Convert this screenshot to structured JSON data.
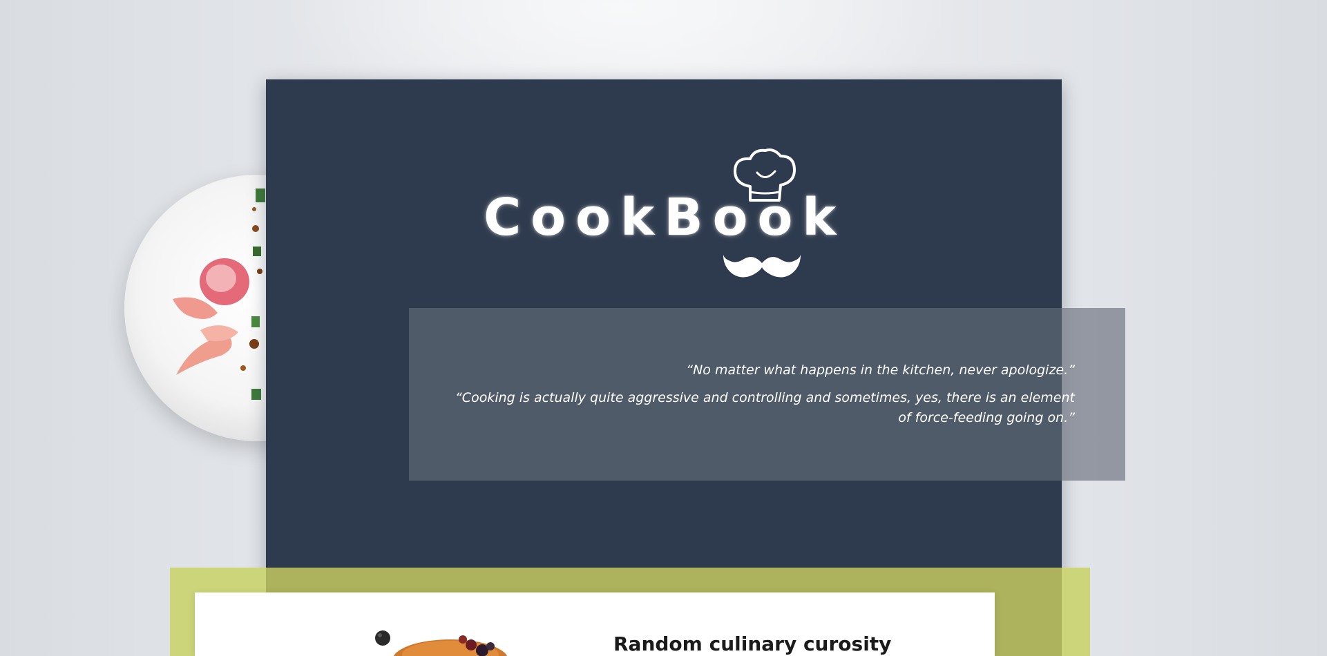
{
  "brand": {
    "name": "CookBook",
    "hat_icon": "chef-hat-icon",
    "mustache_icon": "mustache-icon"
  },
  "quotes": [
    "“No matter what happens in the kitchen, never apologize.”",
    "“Cooking is actually quite aggressive and controlling and sometimes, yes, there is an element of force-feeding going on.”"
  ],
  "feature": {
    "title": "Random culinary curosity"
  },
  "colors": {
    "hero_bg": "#2e3a4d",
    "accent_lime": "#cdd57a",
    "accent_lime_dark": "#adb25c",
    "text_light": "#ffffff"
  }
}
